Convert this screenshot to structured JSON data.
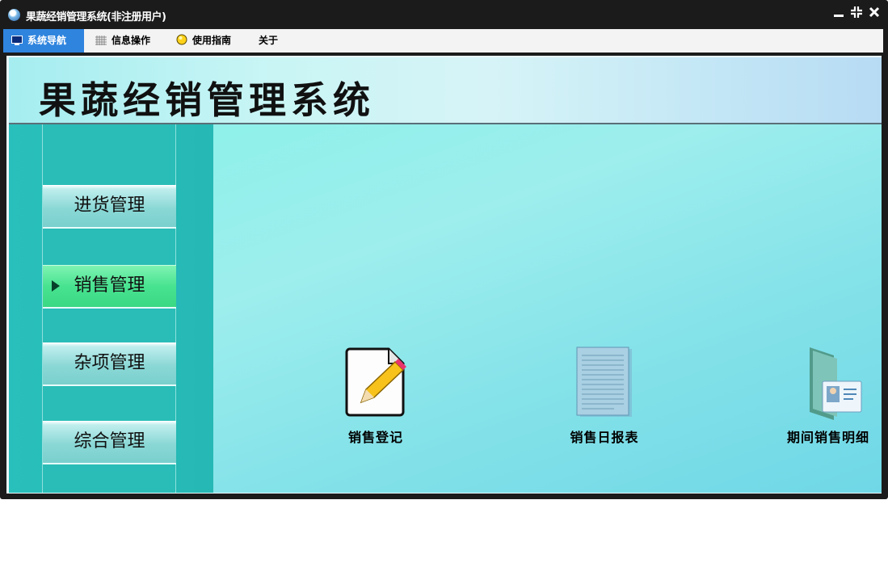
{
  "window": {
    "title": "果蔬经销管理系统(非注册用户)",
    "controls": {
      "minimize": "minimize-icon",
      "restore": "restore-icon",
      "close": "close-icon"
    }
  },
  "menubar": {
    "items": [
      {
        "label": "系统导航",
        "icon": "monitor-icon",
        "active": true
      },
      {
        "label": "信息操作",
        "icon": "grid-icon",
        "active": false
      },
      {
        "label": "使用指南",
        "icon": "bulb-icon",
        "active": false
      },
      {
        "label": "关于",
        "icon": "",
        "active": false
      }
    ]
  },
  "banner": {
    "title": "果蔬经销管理系统"
  },
  "sidebar": {
    "items": [
      {
        "label": "进货管理",
        "active": false
      },
      {
        "label": "销售管理",
        "active": true
      },
      {
        "label": "杂项管理",
        "active": false
      },
      {
        "label": "综合管理",
        "active": false
      }
    ]
  },
  "main": {
    "tiles": [
      {
        "label": "销售登记",
        "icon": "edit-document-icon"
      },
      {
        "label": "销售日报表",
        "icon": "report-document-icon"
      },
      {
        "label": "期间销售明细",
        "icon": "contact-folder-icon"
      }
    ]
  },
  "colors": {
    "accent": "#2f84de",
    "sidebar": "#29bfbb",
    "active_nav": "#48e390",
    "main_bg": "#8ff0ea"
  }
}
